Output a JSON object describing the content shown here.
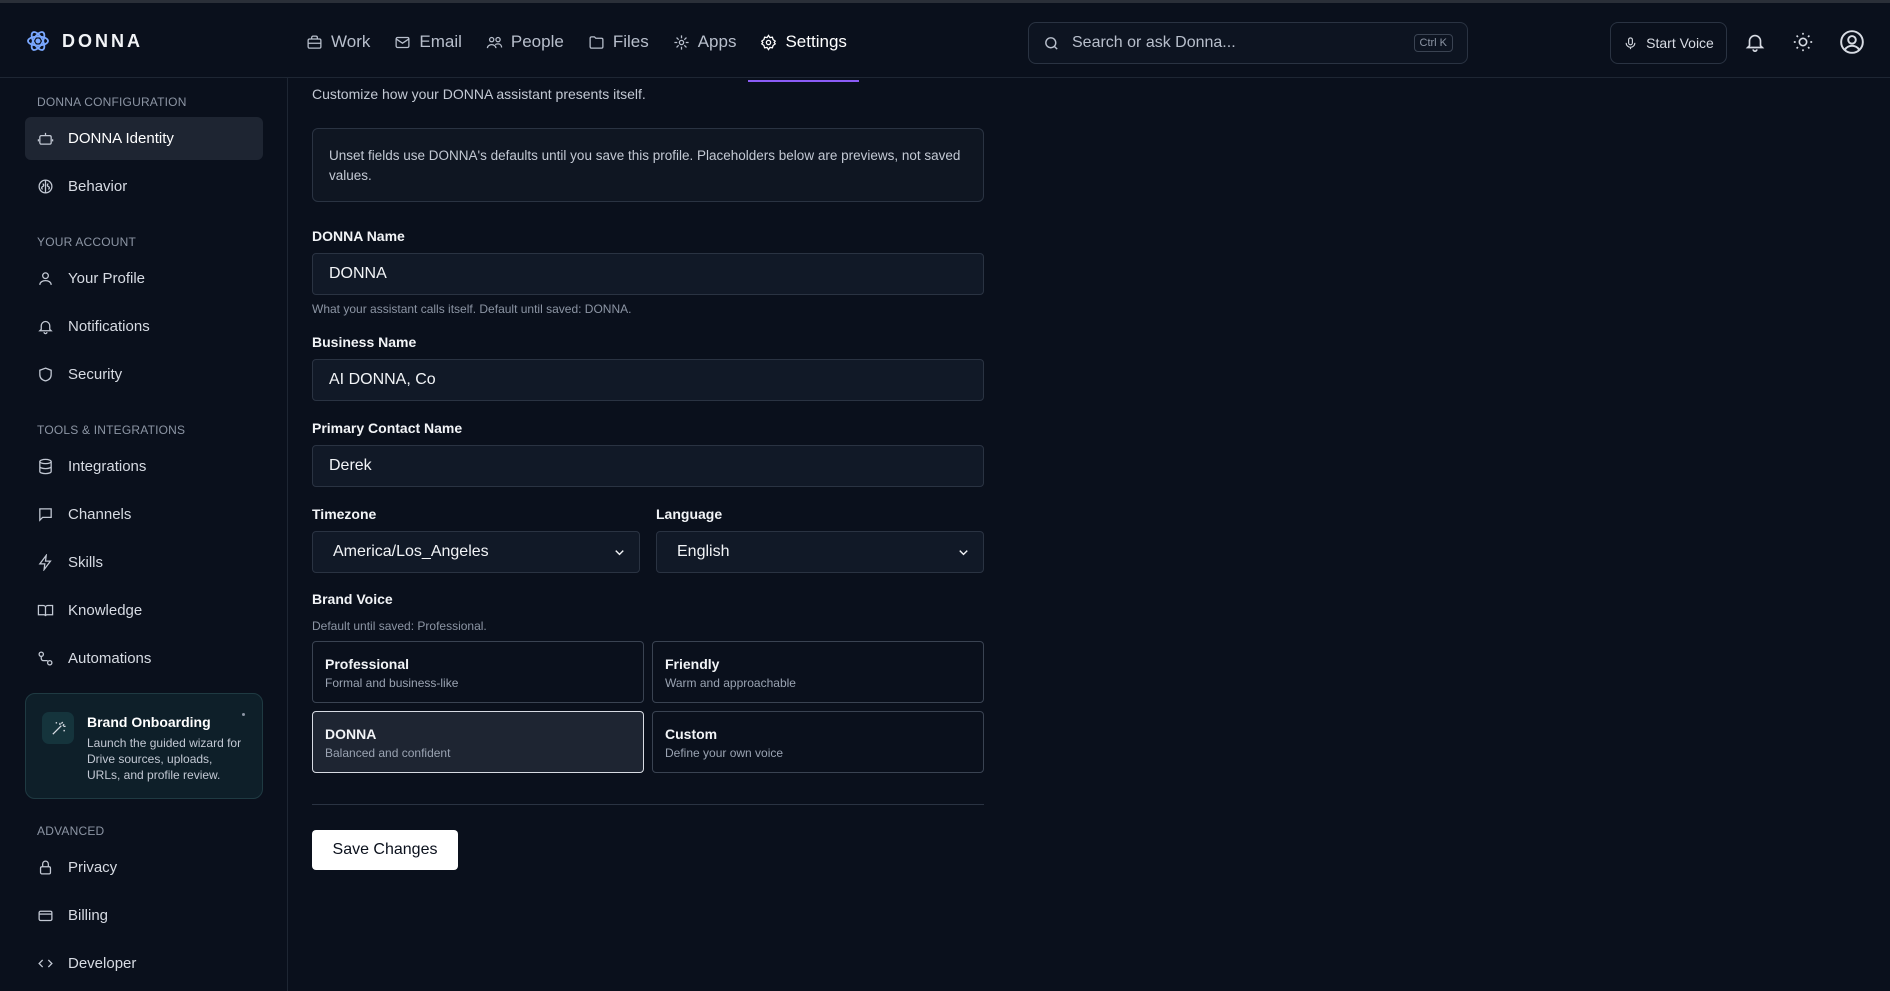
{
  "app": {
    "name": "DONNA"
  },
  "nav": [
    {
      "label": "Work",
      "icon": "briefcase-icon"
    },
    {
      "label": "Email",
      "icon": "mail-icon"
    },
    {
      "label": "People",
      "icon": "people-icon"
    },
    {
      "label": "Files",
      "icon": "folder-icon"
    },
    {
      "label": "Apps",
      "icon": "apps-icon"
    },
    {
      "label": "Settings",
      "icon": "gear-icon",
      "active": true
    }
  ],
  "search": {
    "placeholder": "Search or ask Donna...",
    "shortcut": "Ctrl K"
  },
  "header": {
    "voice_label": "Start Voice"
  },
  "sidebar": {
    "sections": [
      {
        "label": "DONNA CONFIGURATION",
        "items": [
          {
            "label": "DONNA Identity",
            "active": true
          },
          {
            "label": "Behavior"
          }
        ]
      },
      {
        "label": "YOUR ACCOUNT",
        "items": [
          {
            "label": "Your Profile"
          },
          {
            "label": "Notifications"
          },
          {
            "label": "Security"
          }
        ]
      },
      {
        "label": "TOOLS & INTEGRATIONS",
        "items": [
          {
            "label": "Integrations"
          },
          {
            "label": "Channels"
          },
          {
            "label": "Skills"
          },
          {
            "label": "Knowledge"
          },
          {
            "label": "Automations"
          }
        ]
      },
      {
        "label": "ADVANCED",
        "items": [
          {
            "label": "Privacy"
          },
          {
            "label": "Billing"
          },
          {
            "label": "Developer"
          }
        ]
      }
    ],
    "onboarding": {
      "title": "Brand Onboarding",
      "description": "Launch the guided wizard for Drive sources, uploads, URLs, and profile review."
    }
  },
  "main": {
    "subtitle": "Customize how your DONNA assistant presents itself.",
    "notice": "Unset fields use DONNA's defaults until you save this profile. Placeholders below are previews, not saved values.",
    "donna_name": {
      "label": "DONNA Name",
      "value": "DONNA",
      "hint": "What your assistant calls itself. Default until saved: DONNA."
    },
    "business_name": {
      "label": "Business Name",
      "value": "AI DONNA, Co"
    },
    "contact_name": {
      "label": "Primary Contact Name",
      "value": "Derek"
    },
    "timezone": {
      "label": "Timezone",
      "value": "America/Los_Angeles"
    },
    "language": {
      "label": "Language",
      "value": "English"
    },
    "brand_voice": {
      "label": "Brand Voice",
      "hint": "Default until saved: Professional.",
      "options": [
        {
          "title": "Professional",
          "desc": "Formal and business-like"
        },
        {
          "title": "Friendly",
          "desc": "Warm and approachable"
        },
        {
          "title": "DONNA",
          "desc": "Balanced and confident",
          "selected": true
        },
        {
          "title": "Custom",
          "desc": "Define your own voice"
        }
      ]
    },
    "save_label": "Save Changes"
  }
}
